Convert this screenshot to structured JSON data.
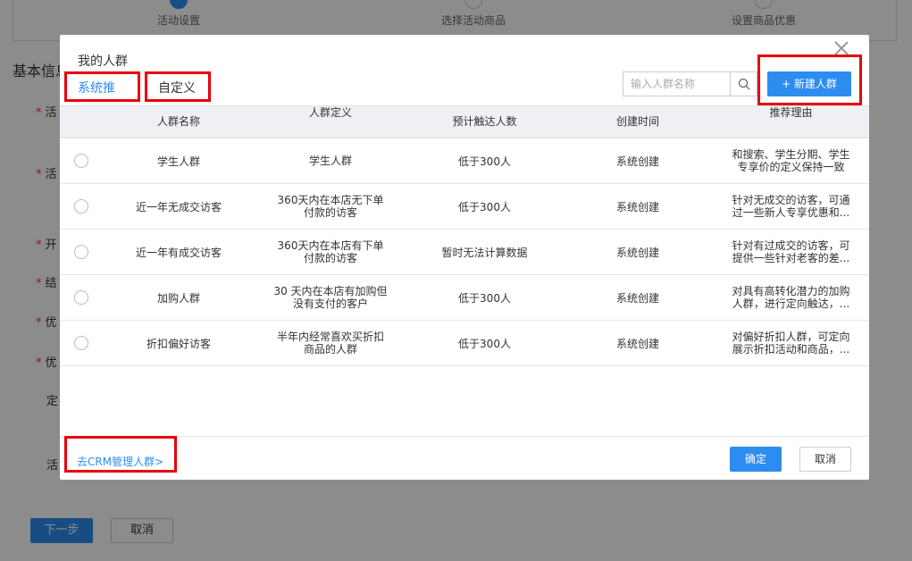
{
  "background": {
    "steps": [
      "活动设置",
      "选择活动商品",
      "设置商品优惠"
    ],
    "section_title": "基本信息",
    "labels": [
      "活",
      "活",
      "开",
      "结",
      "优",
      "优",
      "定",
      "活"
    ],
    "next_label": "下一步",
    "cancel_label": "取消"
  },
  "modal": {
    "title": "我的人群",
    "tabs": [
      {
        "label": "系统推荐",
        "active": true
      },
      {
        "label": "自定义",
        "active": false
      }
    ],
    "search_placeholder": "输入人群名称",
    "new_button": "+ 新建人群",
    "columns": [
      "人群名称",
      "人群定义",
      "预计触达人数",
      "创建时间",
      "推荐理由"
    ],
    "rows": [
      {
        "name": "学生人群",
        "definition": "学生人群",
        "reach": "低于300人",
        "created": "系统创建",
        "reason": "和搜索、学生分期、学生专享价的定义保持一致"
      },
      {
        "name": "近一年无成交访客",
        "definition": "360天内在本店无下单付款的访客",
        "reach": "低于300人",
        "created": "系统创建",
        "reason": "针对无成交的访客，可通过一些新人专享优惠和..."
      },
      {
        "name": "近一年有成交访客",
        "definition": "360天内在本店有下单付款的访客",
        "reach": "暂时无法计算数据",
        "created": "系统创建",
        "reason": "针对有过成交的访客，可提供一些针对老客的差..."
      },
      {
        "name": "加购人群",
        "definition": "30 天内在本店有加购但没有支付的客户",
        "reach": "低于300人",
        "created": "系统创建",
        "reason": "对具有高转化潜力的加购人群，进行定向触达，..."
      },
      {
        "name": "折扣偏好访客",
        "definition": "半年内经常喜欢买折扣商品的人群",
        "reach": "低于300人",
        "created": "系统创建",
        "reason": "对偏好折扣人群，可定向展示折扣活动和商品，..."
      }
    ],
    "crm_link": "去CRM管理人群>",
    "ok_label": "确定",
    "cancel_label": "取消"
  },
  "colors": {
    "accent": "#2d8cf0",
    "highlight_box": "#e8000b"
  }
}
